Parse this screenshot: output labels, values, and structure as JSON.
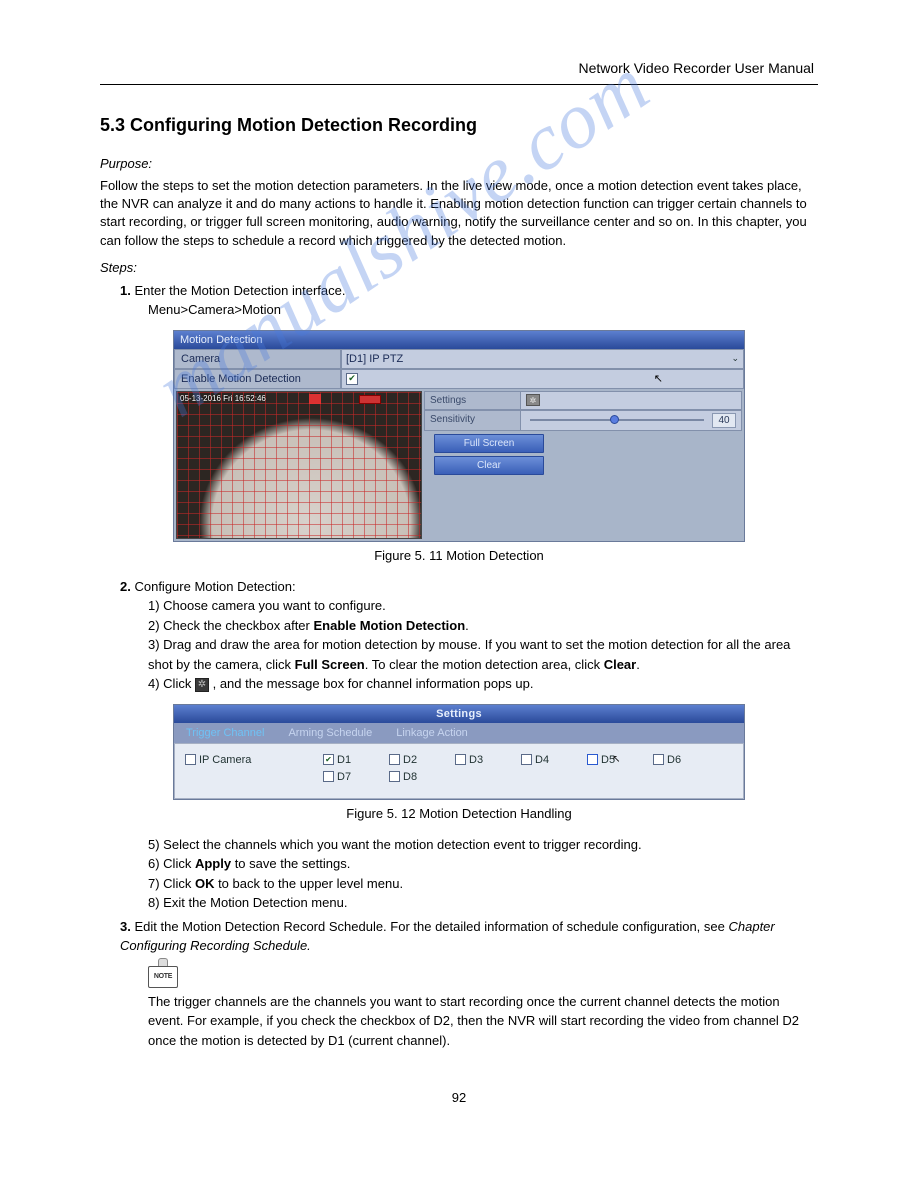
{
  "header": {
    "doc_title": "Network Video Recorder User Manual"
  },
  "page_number": "92",
  "section": {
    "title": "5.3 Configuring Motion Detection Recording",
    "purpose_label": "Purpose:",
    "purpose_text": "Follow the steps to set the motion detection parameters. In the live view mode, once a motion detection event takes place, the NVR can analyze it and do many actions to handle it. Enabling motion detection function can trigger certain channels to start recording, or trigger full screen monitoring, audio warning, notify the surveillance center and so on. In this chapter, you can follow the steps to schedule a record which triggered by the detected motion.",
    "steps_label": "Steps:",
    "step1_num": "1.",
    "step1_text": "Enter the Motion Detection interface.",
    "step1_path": "Menu>Camera>Motion"
  },
  "motion_panel": {
    "title": "Motion Detection",
    "camera_label": "Camera",
    "camera_value": "[D1] IP PTZ",
    "enable_label": "Enable Motion Detection",
    "enable_checked": true,
    "timestamp": "05-13-2016 Fri 16:52:46",
    "settings_label": "Settings",
    "sensitivity_label": "Sensitivity",
    "sensitivity_value": "40",
    "btn_full": "Full Screen",
    "btn_clear": "Clear"
  },
  "fig1_caption": "Figure 5. 11 Motion Detection",
  "step2": {
    "num": "2.",
    "text": "Configure Motion Detection:",
    "s1": "1) Choose camera you want to configure.",
    "s2": "2) Check the checkbox after Enable Motion Detection.",
    "s3": "3) Drag and draw the area for motion detection by mouse. If you want to set the motion detection for all the area shot by the camera, click Full Screen. To clear the motion detection area, click Clear.",
    "s4a": "4) Click",
    "s4b": "Settings, and the message box for channel information pops up."
  },
  "settings_panel": {
    "title": "Settings",
    "tab1": "Trigger Channel",
    "tab2": "Arming Schedule",
    "tab3": "Linkage Action",
    "ipcam_label": "IP Camera",
    "channels": [
      "D1",
      "D2",
      "D3",
      "D4",
      "D5",
      "D6",
      "D7",
      "D8"
    ],
    "checked": [
      "D1"
    ]
  },
  "fig2_caption": "Figure 5. 12 Motion Detection Handling",
  "step2_cont": {
    "s5": "5) Select the channels which you want the motion detection event to trigger recording.",
    "s6": "6) Click Apply to save the settings.",
    "s7": "7) Click OK to back to the upper level menu.",
    "s8": "8) Exit the Motion Detection menu."
  },
  "step3": {
    "num": "3.",
    "text": "Edit the Motion Detection Record Schedule. For the detailed information of schedule configuration, see Chapter Configuring Recording Schedule."
  },
  "note_text": "NOTE",
  "note_body": "The trigger channels are the channels you want to start recording once the current channel detects the motion event. For example, if you check the checkbox of D2, then the NVR will start recording the video from channel D2 once the motion is detected by D1 (current channel).",
  "watermark": "manualshive.com"
}
